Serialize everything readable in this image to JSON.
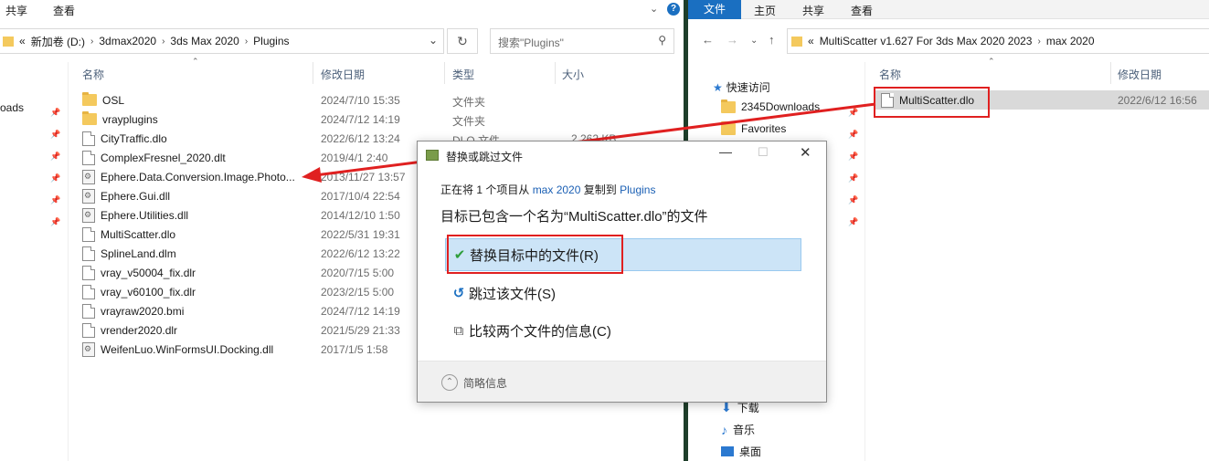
{
  "left_window": {
    "tabs": [
      "共享",
      "查看"
    ],
    "breadcrumb": [
      "«",
      "新加卷 (D:)",
      "3dmax2020",
      "3ds Max 2020",
      "Plugins"
    ],
    "search_placeholder": "搜索\"Plugins\"",
    "columns": [
      "名称",
      "修改日期",
      "类型",
      "大小"
    ],
    "sidebar_partial": "oads",
    "files": [
      {
        "name": "OSL",
        "date": "2024/7/10 15:35",
        "type": "文件夹",
        "size": "",
        "icon": "folder"
      },
      {
        "name": "vrayplugins",
        "date": "2024/7/12 14:19",
        "type": "文件夹",
        "size": "",
        "icon": "folder"
      },
      {
        "name": "CityTraffic.dlo",
        "date": "2022/6/12 13:24",
        "type": "DLO 文件",
        "size": "2,262 KB",
        "icon": "file"
      },
      {
        "name": "ComplexFresnel_2020.dlt",
        "date": "2019/4/1 2:40",
        "type": "",
        "size": "",
        "icon": "file"
      },
      {
        "name": "Ephere.Data.Conversion.Image.Photo...",
        "date": "2013/11/27 13:57",
        "type": "",
        "size": "",
        "icon": "dll"
      },
      {
        "name": "Ephere.Gui.dll",
        "date": "2017/10/4 22:54",
        "type": "",
        "size": "",
        "icon": "dll"
      },
      {
        "name": "Ephere.Utilities.dll",
        "date": "2014/12/10 1:50",
        "type": "",
        "size": "",
        "icon": "dll"
      },
      {
        "name": "MultiScatter.dlo",
        "date": "2022/5/31 19:31",
        "type": "",
        "size": "",
        "icon": "file"
      },
      {
        "name": "SplineLand.dlm",
        "date": "2022/6/12 13:22",
        "type": "",
        "size": "",
        "icon": "file"
      },
      {
        "name": "vray_v50004_fix.dlr",
        "date": "2020/7/15 5:00",
        "type": "",
        "size": "",
        "icon": "file"
      },
      {
        "name": "vray_v60100_fix.dlr",
        "date": "2023/2/15 5:00",
        "type": "",
        "size": "",
        "icon": "file"
      },
      {
        "name": "vrayraw2020.bmi",
        "date": "2024/7/12 14:19",
        "type": "",
        "size": "",
        "icon": "file"
      },
      {
        "name": "vrender2020.dlr",
        "date": "2021/5/29 21:33",
        "type": "",
        "size": "",
        "icon": "file"
      },
      {
        "name": "WeifenLuo.WinFormsUI.Docking.dll",
        "date": "2017/1/5 1:58",
        "type": "",
        "size": "",
        "icon": "dll"
      }
    ]
  },
  "right_window": {
    "tabs": [
      "文件",
      "主页",
      "共享",
      "查看"
    ],
    "breadcrumb": [
      "«",
      "MultiScatter v1.627 For 3ds Max 2020 2023",
      "max 2020"
    ],
    "columns": [
      "名称",
      "修改日期"
    ],
    "quick_access": "快速访问",
    "nav_items": [
      "2345Downloads",
      "Favorites"
    ],
    "nav_bottom": [
      "下载",
      "音乐",
      "桌面"
    ],
    "files": [
      {
        "name": "MultiScatter.dlo",
        "date": "2022/6/12 16:56"
      }
    ]
  },
  "dialog": {
    "title": "替换或跳过文件",
    "copy_prefix": "正在将 1 个项目从",
    "source": "max 2020",
    "copy_mid": "复制到",
    "target": "Plugins",
    "message": "目标已包含一个名为“MultiScatter.dlo”的文件",
    "options": [
      "替换目标中的文件(R)",
      "跳过该文件(S)",
      "比较两个文件的信息(C)"
    ],
    "details": "简略信息"
  },
  "colors": {
    "accent": "#1a6fc1",
    "highlight": "#cce4f7",
    "annotation_red": "#e02020",
    "divider": "#1e3e2a"
  }
}
